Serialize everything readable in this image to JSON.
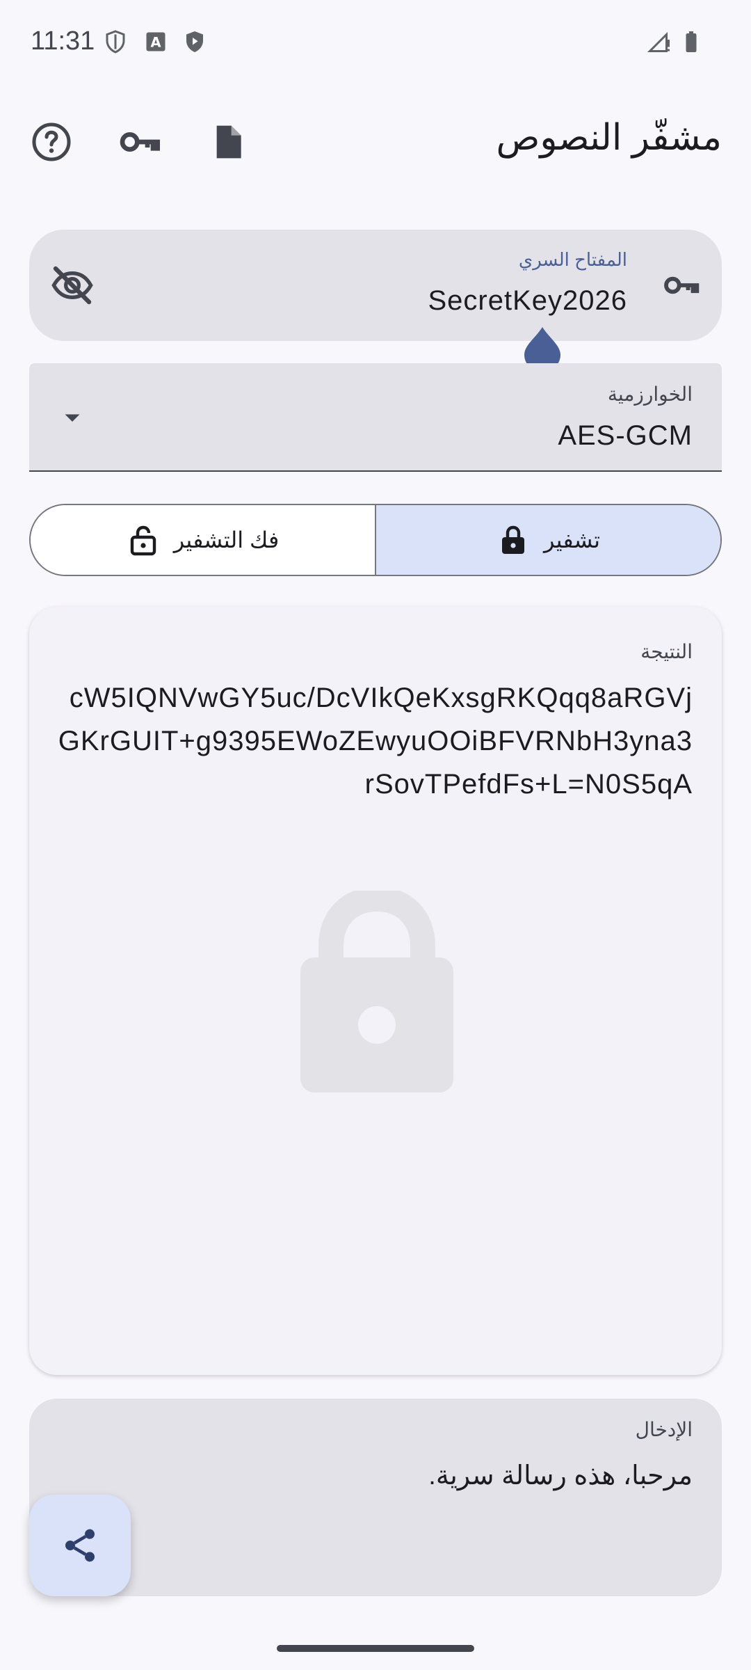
{
  "status_bar": {
    "time": "11:31"
  },
  "app_bar": {
    "title": "مشفّر النصوص"
  },
  "key_field": {
    "label": "المفتاح السري",
    "value": "SecretKey2026"
  },
  "algorithm": {
    "label": "الخوارزمية",
    "value": "AES-GCM"
  },
  "mode": {
    "encrypt_label": "تشفير",
    "decrypt_label": "فك التشفير",
    "selected": "encrypt"
  },
  "result": {
    "label": "النتيجة",
    "text": "cW5IQNVwGY5uc/DcVIkQeKxsgRKQqq8aRGVjGKrGUIT+g9395EWoZEwyuOOiBFVRNbH3yna3rSovTPefdFs+L=N0S5qA"
  },
  "input": {
    "label": "الإدخال",
    "text": "مرحبا، هذه رسالة سرية."
  },
  "colors": {
    "accent": "#4a5f96",
    "surface": "#e3e2e9",
    "selected_segment": "#dae2f9"
  },
  "icons": [
    "shield-icon",
    "font-icon",
    "play-shield-icon",
    "signal-icon",
    "battery-icon",
    "help-icon",
    "key-icon",
    "document-icon",
    "visibility-off-icon",
    "dropdown-arrow-icon",
    "lock-icon",
    "lock-open-icon",
    "share-icon"
  ]
}
